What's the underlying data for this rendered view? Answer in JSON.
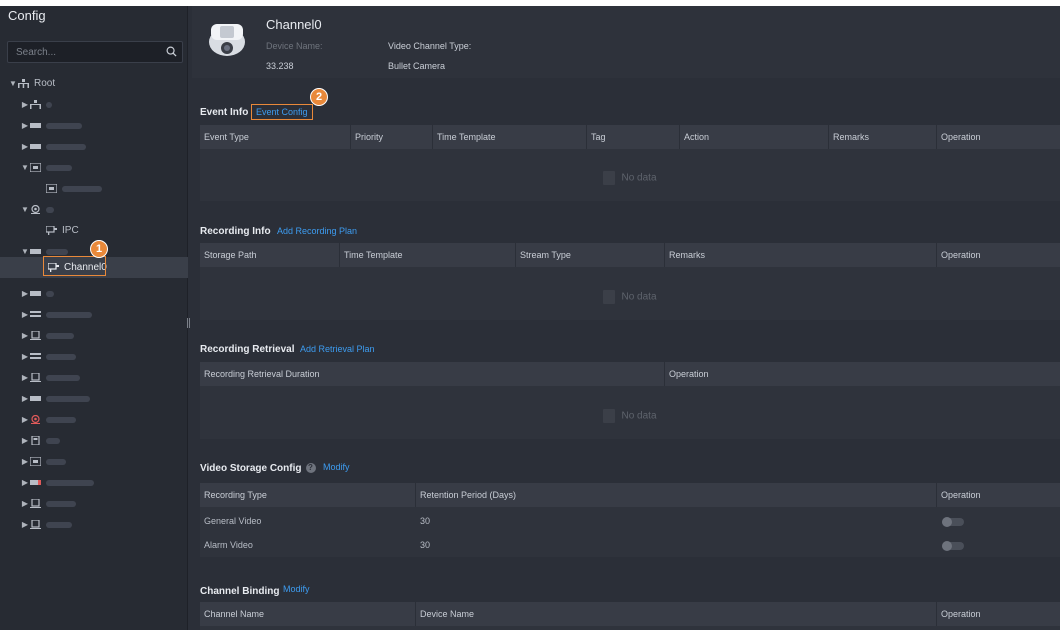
{
  "sidebar": {
    "title": "Config",
    "search_placeholder": "Search...",
    "root_label": "Root",
    "ipc_label": "IPC",
    "selected_label": "Channel0"
  },
  "annotations": {
    "step1": "1",
    "step2": "2"
  },
  "header": {
    "channel_name": "Channel0",
    "device_name_label": "Device Name:",
    "device_name_value": "33.238",
    "video_channel_type_label": "Video Channel Type:",
    "video_channel_type_value": "Bullet Camera"
  },
  "event_info": {
    "title": "Event Info",
    "link": "Event Config",
    "columns": [
      "Event Type",
      "Priority",
      "Time Template",
      "Tag",
      "Action",
      "Remarks",
      "Operation"
    ],
    "empty": "No data"
  },
  "recording_info": {
    "title": "Recording Info",
    "link": "Add Recording Plan",
    "columns": [
      "Storage Path",
      "Time Template",
      "Stream Type",
      "Remarks",
      "Operation"
    ],
    "empty": "No data"
  },
  "recording_retrieval": {
    "title": "Recording Retrieval",
    "link": "Add Retrieval Plan",
    "columns": [
      "Recording Retrieval Duration",
      "Operation"
    ],
    "empty": "No data"
  },
  "video_storage": {
    "title": "Video Storage Config",
    "link": "Modify",
    "columns": [
      "Recording Type",
      "Retention Period (Days)",
      "Operation"
    ],
    "rows": [
      {
        "type": "General Video",
        "days": "30",
        "enabled": false
      },
      {
        "type": "Alarm Video",
        "days": "30",
        "enabled": false
      }
    ]
  },
  "channel_binding": {
    "title": "Channel Binding",
    "link": "Modify",
    "columns": [
      "Channel Name",
      "Device Name",
      "Operation"
    ]
  },
  "colors": {
    "accent": "#3d9cf0",
    "highlight": "#e9893a",
    "panel": "#2b2f38"
  }
}
